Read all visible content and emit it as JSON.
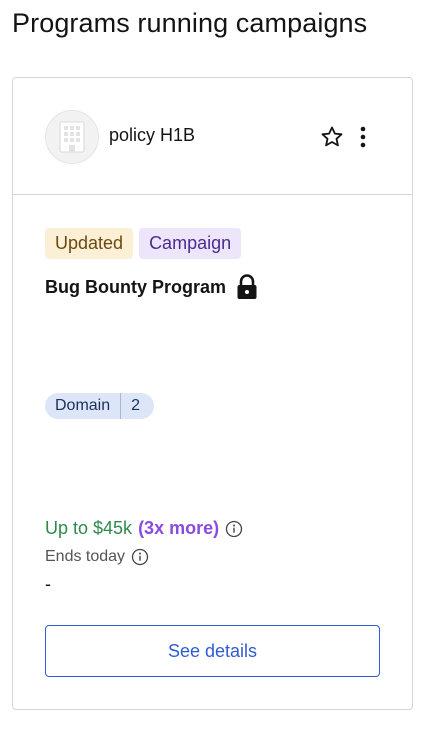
{
  "page": {
    "title": "Programs running campaigns"
  },
  "card": {
    "program_name": "policy H1B",
    "avatar_icon": "building-icon",
    "tags": [
      "Updated",
      "Campaign"
    ],
    "title": "Bug Bounty Program",
    "lock_icon": "lock-icon",
    "domain": {
      "label": "Domain",
      "count": "2"
    },
    "reward": {
      "amount": "Up to $45k",
      "more": "(3x more)"
    },
    "ends": "Ends today",
    "dash": "-",
    "details_label": "See details"
  },
  "colors": {
    "tag_updated_bg": "#fbefd5",
    "tag_campaign_bg": "#ede6fb",
    "reward_green": "#2f8a4a",
    "reward_purple": "#8a4be0",
    "button_blue": "#2f5bd6"
  }
}
